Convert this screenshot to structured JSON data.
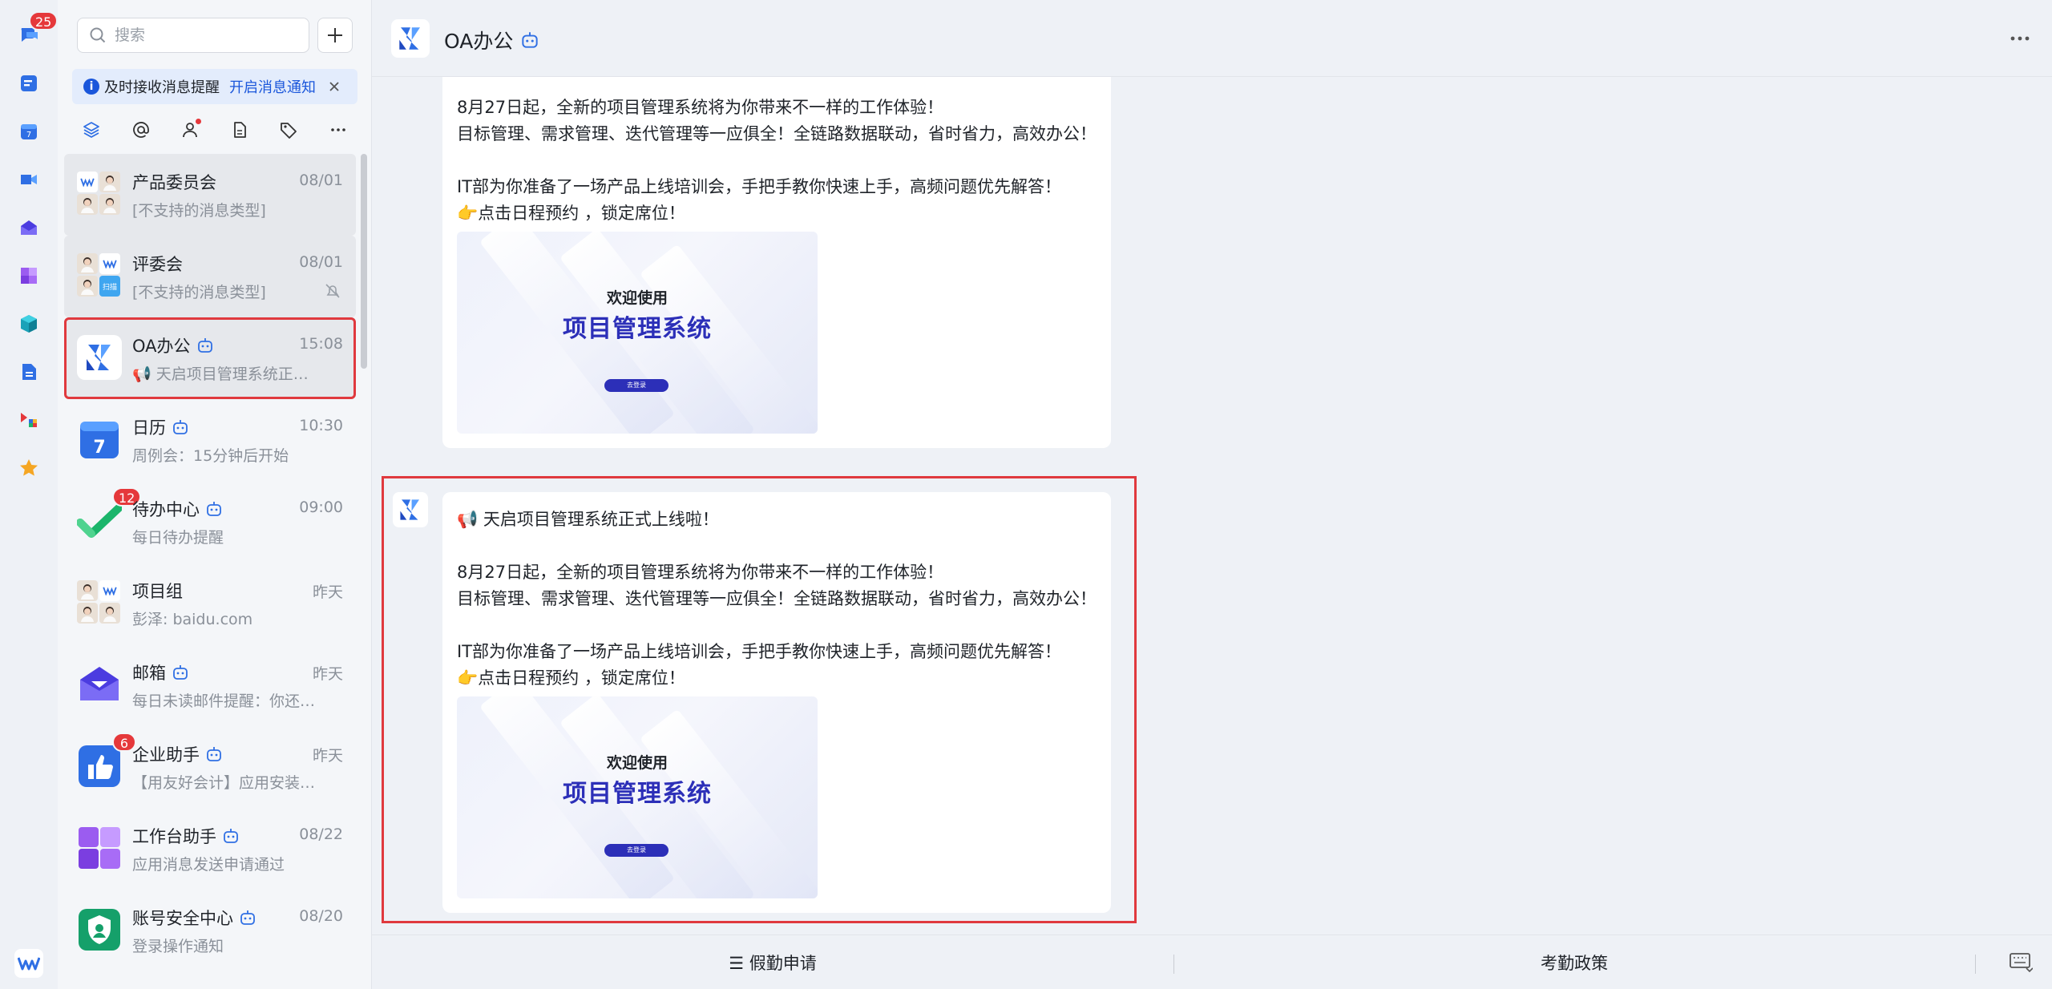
{
  "rail": {
    "chat_badge": "25",
    "items": [
      "chat-icon",
      "docs-icon",
      "calendar-icon",
      "meeting-icon",
      "mail-icon",
      "workbench-icon",
      "apps-icon",
      "file-icon",
      "multi-app-icon",
      "star-icon"
    ]
  },
  "search": {
    "placeholder": "搜索"
  },
  "notice": {
    "text": "及时接收消息提醒",
    "link": "开启消息通知"
  },
  "conversations": [
    {
      "name": "产品委员会",
      "time": "08/01",
      "preview": "[不支持的消息类型]",
      "bot": false
    },
    {
      "name": "评委会",
      "time": "08/01",
      "preview": "[不支持的消息类型]",
      "bot": false,
      "muted": true
    },
    {
      "name": "OA办公",
      "time": "15:08",
      "preview": "天启项目管理系统正式上线啦！",
      "bot": true
    },
    {
      "name": "日历",
      "time": "10:30",
      "preview": "周例会：15分钟后开始",
      "bot": true
    },
    {
      "name": "待办中心",
      "time": "09:00",
      "preview": "每日待办提醒",
      "bot": true,
      "badge": "12"
    },
    {
      "name": "项目组",
      "time": "昨天",
      "preview": "彭泽: baidu.com",
      "bot": false
    },
    {
      "name": "邮箱",
      "time": "昨天",
      "preview": "每日未读邮件提醒：你还有...",
      "bot": true
    },
    {
      "name": "企业助手",
      "time": "昨天",
      "preview": "【用友好会计】应用安装成...",
      "bot": true,
      "badge": "6"
    },
    {
      "name": "工作台助手",
      "time": "08/22",
      "preview": "应用消息发送申请通过",
      "bot": true
    },
    {
      "name": "账号安全中心",
      "time": "08/20",
      "preview": "登录操作通知",
      "bot": true
    }
  ],
  "group_avatar_label": "扫描",
  "chat": {
    "title": "OA办公",
    "messages": [
      {
        "text": "8月27日起，全新的项目管理系统将为你带来不一样的工作体验！\n目标管理、需求管理、迭代管理等一应俱全！全链路数据联动，省时省力，高效办公！\n\nIT部为你准备了一场产品上线培训会，手把手教你快速上手，高频问题优先解答！\n👉点击日程预约 ，锁定席位！",
        "banner": {
          "welcome": "欢迎使用",
          "title": "项目管理系统",
          "button": "去登录"
        }
      },
      {
        "text": "📢 天启项目管理系统正式上线啦！\n\n8月27日起，全新的项目管理系统将为你带来不一样的工作体验！\n目标管理、需求管理、迭代管理等一应俱全！全链路数据联动，省时省力，高效办公！\n\nIT部为你准备了一场产品上线培训会，手把手教你快速上手，高频问题优先解答！\n👉点击日程预约 ，锁定席位！",
        "banner": {
          "welcome": "欢迎使用",
          "title": "项目管理系统",
          "button": "去登录"
        }
      }
    ]
  },
  "bottom_menu": {
    "menu1": "☰  假勤申请",
    "menu2": "考勤政策"
  },
  "colors": {
    "accent": "#1a56db",
    "badge": "#e5383b",
    "selection": "#e0393e",
    "banner_title": "#2c2fb8"
  }
}
